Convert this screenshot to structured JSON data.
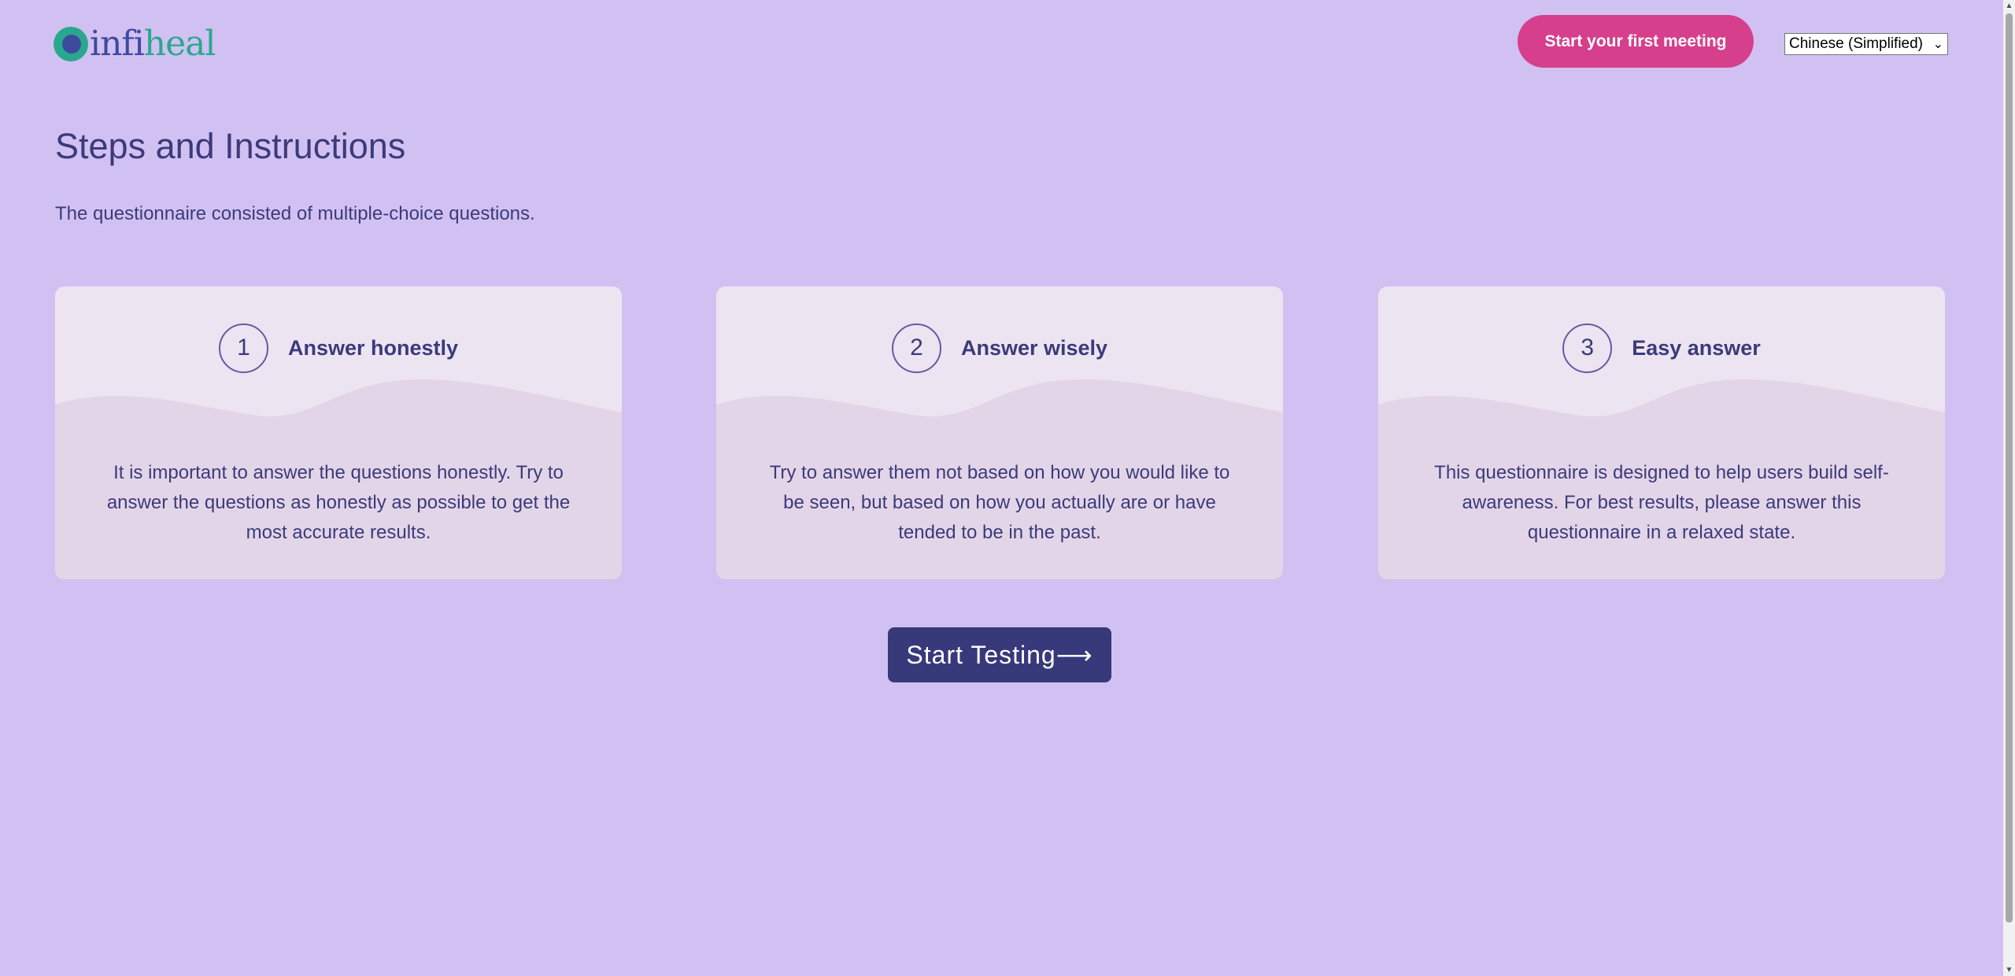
{
  "header": {
    "logo_text_a": "infi",
    "logo_text_b": "heal",
    "cta_label": "Start your first meeting",
    "language_selected": "Chinese (Simplified)"
  },
  "main": {
    "title": "Steps and Instructions",
    "intro": "The questionnaire consisted of multiple-choice questions.",
    "cards": [
      {
        "number": "1",
        "title": "Answer honestly",
        "body": "It is important to answer the questions honestly. Try to answer the questions as honestly as possible to get the most accurate results."
      },
      {
        "number": "2",
        "title": "Answer wisely",
        "body": "Try to answer them not based on how you would like to be seen, but based on how you actually are or have tended to be in the past."
      },
      {
        "number": "3",
        "title": "Easy answer",
        "body": "This questionnaire is designed to help users build self-awareness. For best results, please answer this questionnaire in a relaxed state."
      }
    ],
    "start_label": "Start Testing⟶"
  },
  "colors": {
    "background": "#d1c1f2",
    "accent_pink": "#d63f8c",
    "primary_navy": "#37397a",
    "card_light": "#ede4f1",
    "card_dark": "#e3d5e8",
    "logo_green": "#2aa88e",
    "logo_blue": "#3d4b9e"
  }
}
